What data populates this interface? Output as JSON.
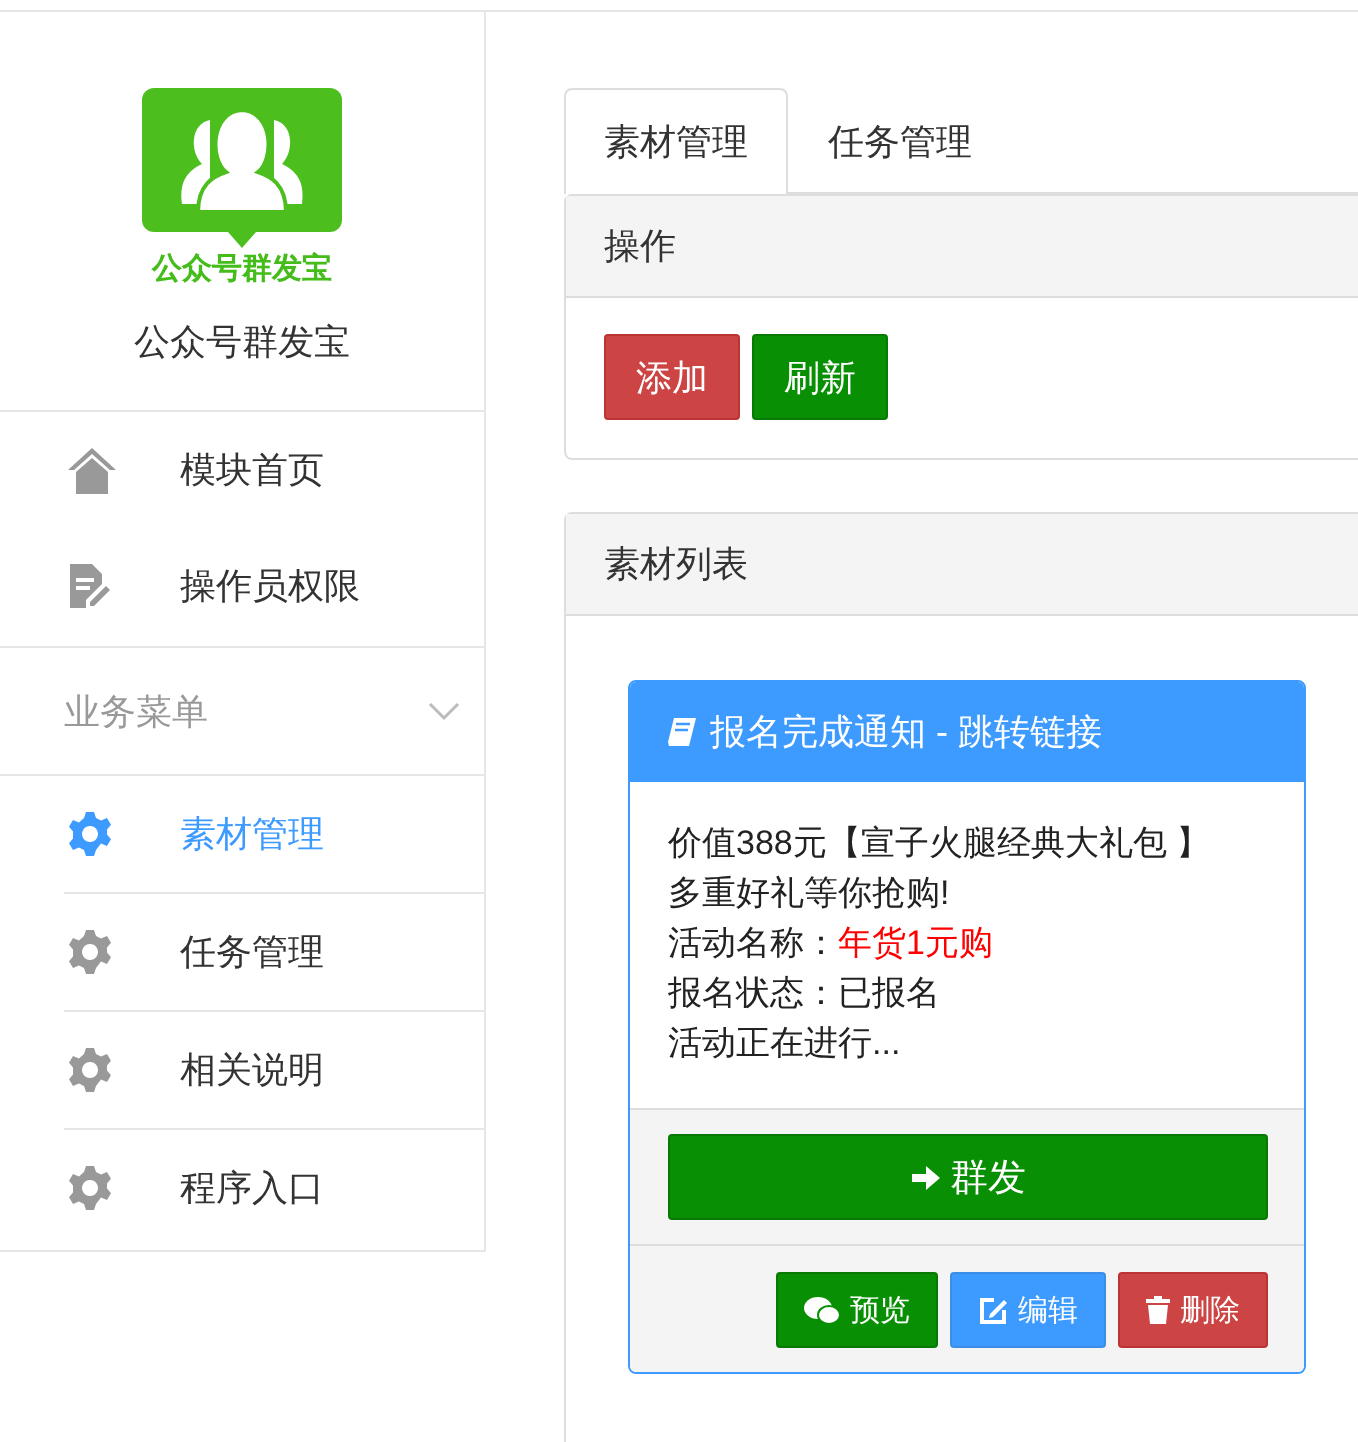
{
  "sidebar": {
    "logo": {
      "caption": "公众号群发宝"
    },
    "title": "公众号群发宝",
    "top_items": [
      {
        "label": "模块首页",
        "selected": false
      },
      {
        "label": "操作员权限",
        "selected": false
      }
    ],
    "group": {
      "label": "业务菜单",
      "expanded": true,
      "items": [
        {
          "label": "素材管理",
          "selected": true
        },
        {
          "label": "任务管理",
          "selected": false
        },
        {
          "label": "相关说明",
          "selected": false
        },
        {
          "label": "程序入口",
          "selected": false
        }
      ]
    }
  },
  "tabs": [
    {
      "label": "素材管理",
      "selected": true
    },
    {
      "label": "任务管理",
      "selected": false
    }
  ],
  "actions_panel": {
    "title": "操作",
    "buttons": [
      {
        "label": "添加",
        "kind": "danger"
      },
      {
        "label": "刷新",
        "kind": "success"
      }
    ]
  },
  "list_panel": {
    "title": "素材列表",
    "cards": [
      {
        "title": "报名完成通知 - 跳转链接",
        "lines": [
          {
            "text": "价值388元【宣子火腿经典大礼包 】"
          },
          {
            "text": "多重好礼等你抢购!"
          },
          {
            "label": "活动名称：",
            "value": "年货1元购",
            "highlight": true
          },
          {
            "label": "报名状态：",
            "value": "已报名",
            "highlight": false
          },
          {
            "text": "活动正在进行..."
          }
        ],
        "send_button": "群发",
        "buttons": [
          {
            "label": "预览",
            "kind": "success"
          },
          {
            "label": "编辑",
            "kind": "primary"
          },
          {
            "label": "删除",
            "kind": "danger"
          }
        ]
      }
    ]
  }
}
